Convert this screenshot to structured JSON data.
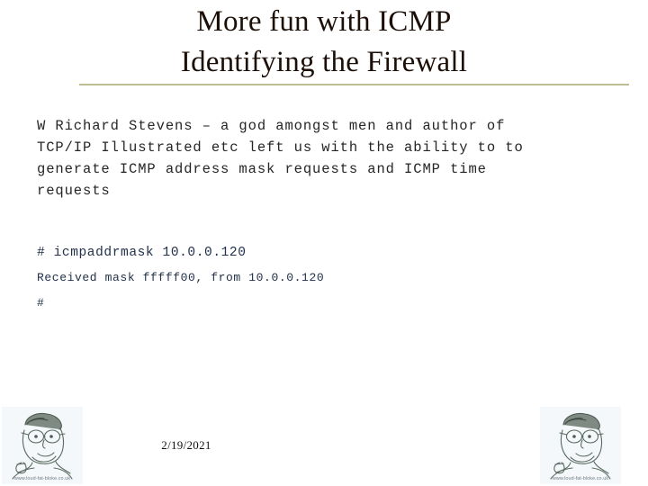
{
  "slide": {
    "title": {
      "line1": "More fun with ICMP",
      "line2": "Identifying the Firewall",
      "color": "#1c0f08"
    },
    "divider": {
      "color": "#bfbd92"
    },
    "body": {
      "paragraph": "W Richard Stevens – a god amongst men and author of\nTCP/IP Illustrated etc left us with the ability to to\ngenerate ICMP address mask requests and ICMP time\nrequests",
      "color": "#262626"
    },
    "terminal": {
      "color": "#22314a",
      "lines": [
        "# icmpaddrmask 10.0.0.120",
        "Received mask fffff00, from 10.0.0.120",
        "#"
      ]
    },
    "footer": {
      "date": "2/19/2021"
    },
    "corner_images": {
      "left": {
        "caption": "www.loud-fat-bloke.co.uk",
        "alt": "caricature-line-drawing"
      },
      "right": {
        "caption": "www.loud-fat-bloke.co.uk",
        "alt": "caricature-line-drawing"
      }
    }
  }
}
